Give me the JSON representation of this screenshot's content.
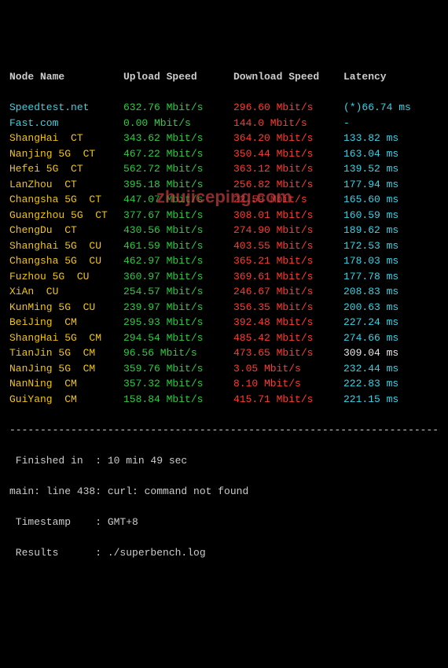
{
  "header": {
    "node": "Node Name",
    "up": "Upload Speed",
    "down": "Download Speed",
    "lat": "Latency"
  },
  "rows": [
    {
      "node": "Speedtest.net",
      "node_color": "cyan",
      "up": "632.76 Mbit/s",
      "down": "296.60 Mbit/s",
      "lat": "(*)66.74 ms",
      "lat_color": "cyan"
    },
    {
      "node": "Fast.com",
      "node_color": "cyan",
      "up": "0.00 Mbit/s",
      "down": "144.0 Mbit/s",
      "lat": "-",
      "lat_color": "cyan"
    },
    {
      "node": "ShangHai  CT",
      "node_color": "yellow",
      "up": "343.62 Mbit/s",
      "down": "364.20 Mbit/s",
      "lat": "133.82 ms",
      "lat_color": "cyan"
    },
    {
      "node": "Nanjing 5G  CT",
      "node_color": "yellow",
      "up": "467.22 Mbit/s",
      "down": "350.44 Mbit/s",
      "lat": "163.04 ms",
      "lat_color": "cyan"
    },
    {
      "node": "Hefei 5G  CT",
      "node_color": "yellow",
      "up": "562.72 Mbit/s",
      "down": "363.12 Mbit/s",
      "lat": "139.52 ms",
      "lat_color": "cyan"
    },
    {
      "node": "LanZhou  CT",
      "node_color": "yellow",
      "up": "395.18 Mbit/s",
      "down": "256.82 Mbit/s",
      "lat": "177.94 ms",
      "lat_color": "cyan"
    },
    {
      "node": "Changsha 5G  CT",
      "node_color": "yellow",
      "up": "447.07 Mbit/s",
      "down": "22.59 Mbit/s",
      "lat": "165.60 ms",
      "lat_color": "cyan"
    },
    {
      "node": "Guangzhou 5G  CT",
      "node_color": "yellow",
      "up": "377.67 Mbit/s",
      "down": "308.01 Mbit/s",
      "lat": "160.59 ms",
      "lat_color": "cyan"
    },
    {
      "node": "ChengDu  CT",
      "node_color": "yellow",
      "up": "430.56 Mbit/s",
      "down": "274.90 Mbit/s",
      "lat": "189.62 ms",
      "lat_color": "cyan"
    },
    {
      "node": "Shanghai 5G  CU",
      "node_color": "yellow",
      "up": "461.59 Mbit/s",
      "down": "403.55 Mbit/s",
      "lat": "172.53 ms",
      "lat_color": "cyan"
    },
    {
      "node": "Changsha 5G  CU",
      "node_color": "yellow",
      "up": "462.97 Mbit/s",
      "down": "365.21 Mbit/s",
      "lat": "178.03 ms",
      "lat_color": "cyan"
    },
    {
      "node": "Fuzhou 5G  CU",
      "node_color": "yellow",
      "up": "360.97 Mbit/s",
      "down": "369.61 Mbit/s",
      "lat": "177.78 ms",
      "lat_color": "cyan"
    },
    {
      "node": "XiAn  CU",
      "node_color": "yellow",
      "up": "254.57 Mbit/s",
      "down": "246.67 Mbit/s",
      "lat": "208.83 ms",
      "lat_color": "cyan"
    },
    {
      "node": "KunMing 5G  CU",
      "node_color": "yellow",
      "up": "239.97 Mbit/s",
      "down": "356.35 Mbit/s",
      "lat": "200.63 ms",
      "lat_color": "cyan"
    },
    {
      "node": "BeiJing  CM",
      "node_color": "yellow",
      "up": "295.93 Mbit/s",
      "down": "392.48 Mbit/s",
      "lat": "227.24 ms",
      "lat_color": "cyan"
    },
    {
      "node": "ShangHai 5G  CM",
      "node_color": "yellow",
      "up": "294.54 Mbit/s",
      "down": "485.42 Mbit/s",
      "lat": "274.66 ms",
      "lat_color": "cyan"
    },
    {
      "node": "TianJin 5G  CM",
      "node_color": "yellow",
      "up": "96.56 Mbit/s",
      "down": "473.65 Mbit/s",
      "lat": "309.04 ms",
      "lat_color": "white"
    },
    {
      "node": "NanJing 5G  CM",
      "node_color": "yellow",
      "up": "359.76 Mbit/s",
      "down": "3.05 Mbit/s",
      "lat": "232.44 ms",
      "lat_color": "cyan"
    },
    {
      "node": "NanNing  CM",
      "node_color": "yellow",
      "up": "357.32 Mbit/s",
      "down": "8.10 Mbit/s",
      "lat": "222.83 ms",
      "lat_color": "cyan"
    },
    {
      "node": "GuiYang  CM",
      "node_color": "yellow",
      "up": "158.84 Mbit/s",
      "down": "415.71 Mbit/s",
      "lat": "221.15 ms",
      "lat_color": "cyan"
    }
  ],
  "divider": "----------------------------------------------------------------------",
  "footer": {
    "finished": " Finished in  : 10 min 49 sec",
    "error": "main: line 438: curl: command not found",
    "timestamp": " Timestamp    : GMT+8",
    "results": " Results      : ./superbench.log"
  },
  "watermark": "zhujiceping.com"
}
